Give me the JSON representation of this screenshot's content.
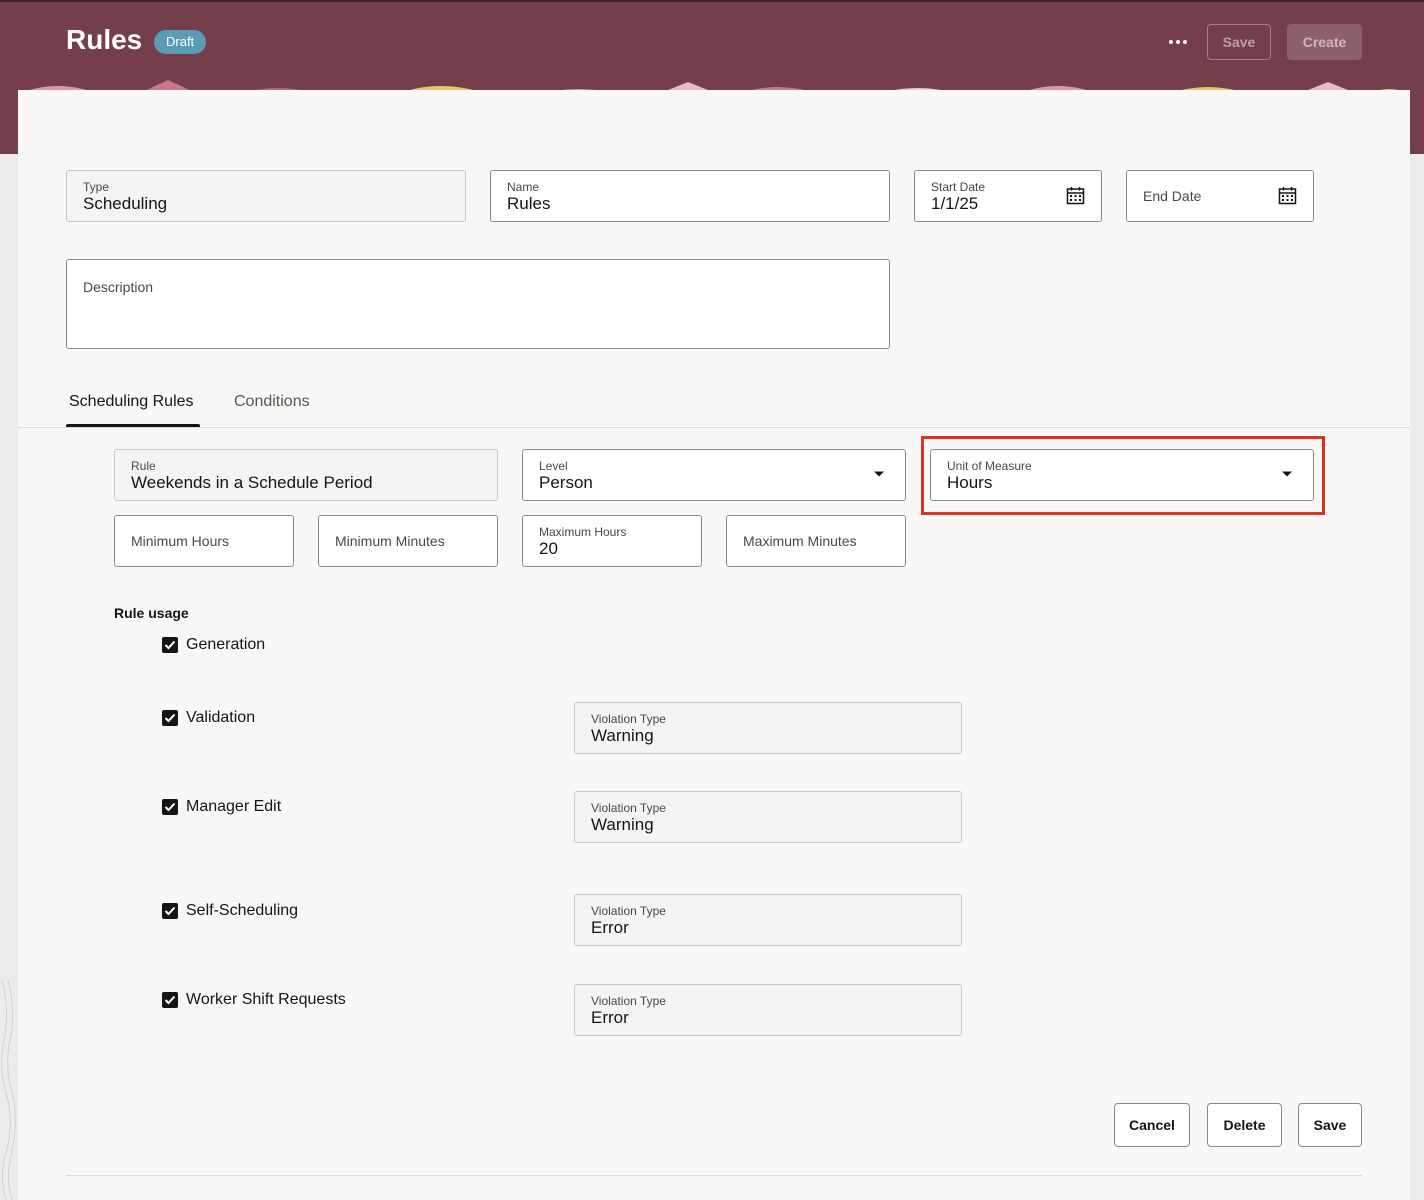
{
  "header": {
    "title": "Rules",
    "status_badge": "Draft",
    "more_icon": "more-horizontal-icon",
    "save_label": "Save",
    "create_label": "Create",
    "bg_color": "#743f4a"
  },
  "form": {
    "type": {
      "label": "Type",
      "value": "Scheduling"
    },
    "name": {
      "label": "Name",
      "value": "Rules"
    },
    "start_date": {
      "label": "Start Date",
      "value": "1/1/25",
      "icon": "calendar-icon"
    },
    "end_date": {
      "label": "End Date",
      "icon": "calendar-icon"
    },
    "description": {
      "label": "Description",
      "value": ""
    }
  },
  "tabs": [
    {
      "label": "Scheduling Rules",
      "active": true
    },
    {
      "label": "Conditions",
      "active": false
    }
  ],
  "rule": {
    "rule": {
      "label": "Rule",
      "value": "Weekends in a Schedule Period"
    },
    "level": {
      "label": "Level",
      "value": "Person",
      "icon": "chevron-down-icon"
    },
    "unit_of_measure": {
      "label": "Unit of Measure",
      "value": "Hours",
      "icon": "chevron-down-icon"
    },
    "minimum_hours": {
      "label": "Minimum Hours"
    },
    "minimum_minutes": {
      "label": "Minimum Minutes"
    },
    "maximum_hours": {
      "label": "Maximum Hours",
      "value": "20"
    },
    "maximum_minutes": {
      "label": "Maximum Minutes"
    }
  },
  "rule_usage": {
    "title": "Rule usage",
    "items": [
      {
        "label": "Generation",
        "checked": true
      },
      {
        "label": "Validation",
        "checked": true,
        "violation_label": "Violation Type",
        "violation_value": "Warning"
      },
      {
        "label": "Manager Edit",
        "checked": true,
        "violation_label": "Violation Type",
        "violation_value": "Warning"
      },
      {
        "label": "Self-Scheduling",
        "checked": true,
        "violation_label": "Violation Type",
        "violation_value": "Error"
      },
      {
        "label": "Worker Shift Requests",
        "checked": true,
        "violation_label": "Violation Type",
        "violation_value": "Error"
      }
    ]
  },
  "actions": {
    "cancel": "Cancel",
    "delete": "Delete",
    "save": "Save"
  },
  "highlight_color": "#e0301e"
}
